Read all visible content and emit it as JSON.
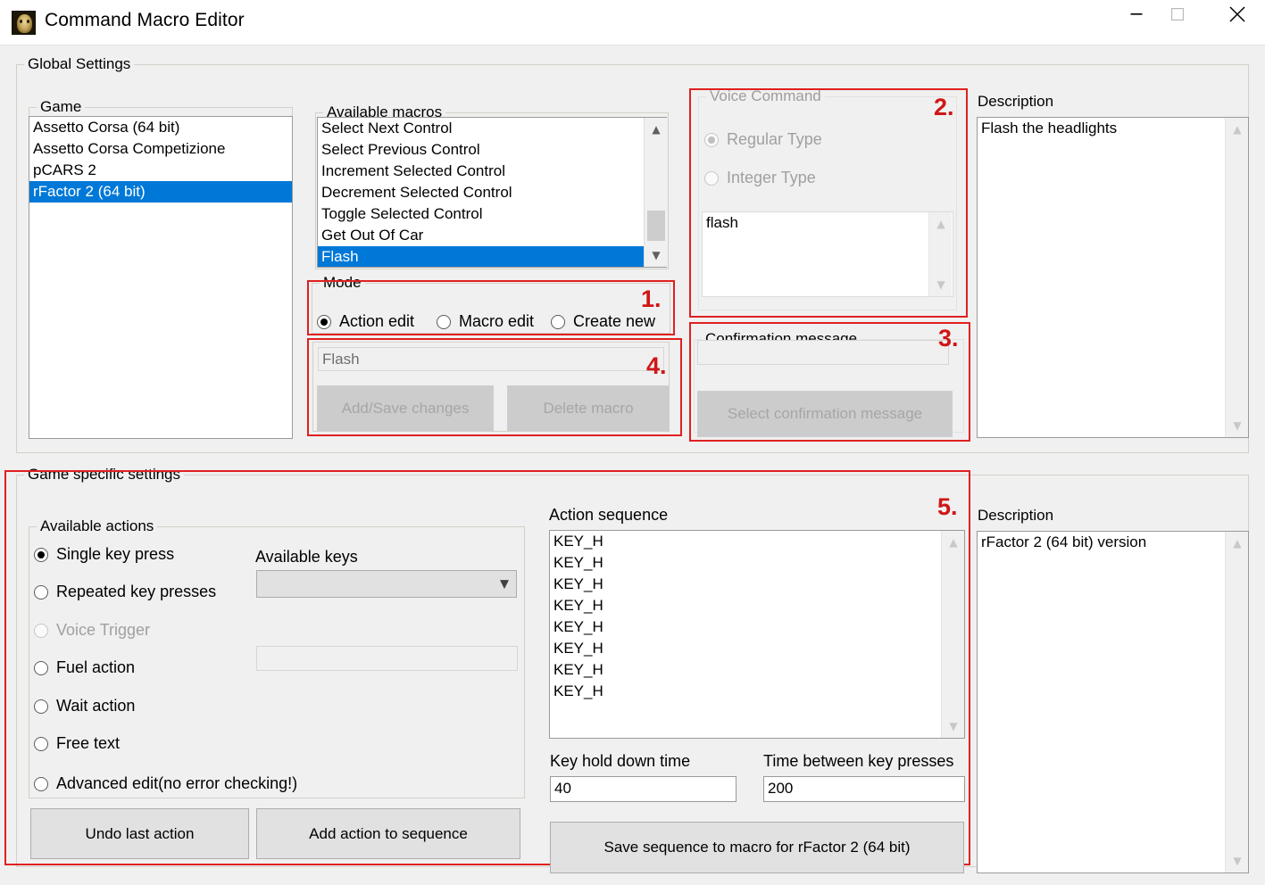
{
  "window": {
    "title": "Command Macro Editor",
    "icon": "app-face-icon",
    "controls": {
      "minimize": "minimize",
      "maximize": "maximize",
      "close": "close"
    }
  },
  "global_settings": {
    "title": "Global Settings",
    "game": {
      "label": "Game",
      "items": [
        "Assetto Corsa (64 bit)",
        "Assetto Corsa Competizione",
        "pCARS 2",
        "rFactor 2 (64 bit)"
      ],
      "selected": "rFactor 2 (64 bit)",
      "selected_index": 3
    },
    "available_macros": {
      "label": "Available macros",
      "items": [
        "Select Next Control",
        "Select Previous Control",
        "Increment Selected Control",
        "Decrement Selected Control",
        "Toggle Selected Control",
        "Get Out Of Car",
        "Flash"
      ],
      "selected": "Flash",
      "selected_index": 6
    },
    "mode": {
      "label": "Mode",
      "options": [
        "Action edit",
        "Macro edit",
        "Create new"
      ],
      "selected": "Action edit",
      "annotation": "1."
    },
    "macro_actions": {
      "macro_name_value": "Flash",
      "add_save_label": "Add/Save changes",
      "delete_label": "Delete macro",
      "enabled": false,
      "annotation": "4."
    },
    "voice_command": {
      "label": "Voice Command",
      "enabled": false,
      "options": [
        "Regular Type",
        "Integer Type"
      ],
      "selected": "Regular Type",
      "list_items": [
        "flash"
      ],
      "annotation": "2."
    },
    "confirmation_message": {
      "label": "Confirmation message",
      "field_value": "",
      "button_label": "Select confirmation message",
      "button_enabled": false,
      "annotation": "3."
    },
    "description": {
      "label": "Description",
      "text": "Flash the headlights"
    }
  },
  "game_specific_settings": {
    "title": "Game specific settings",
    "annotation": "5.",
    "available_actions": {
      "label": "Available actions",
      "options": [
        {
          "label": "Single key press",
          "enabled": true,
          "selected": true
        },
        {
          "label": "Repeated key presses",
          "enabled": true,
          "selected": false
        },
        {
          "label": "Voice Trigger",
          "enabled": false,
          "selected": false
        },
        {
          "label": "Fuel action",
          "enabled": true,
          "selected": false
        },
        {
          "label": "Wait action",
          "enabled": true,
          "selected": false
        },
        {
          "label": "Free text",
          "enabled": true,
          "selected": false
        },
        {
          "label": "Advanced edit(no error checking!)",
          "enabled": true,
          "selected": false
        }
      ]
    },
    "available_keys": {
      "label": "Available keys",
      "selected_value": "",
      "icon": "chevron-down-icon"
    },
    "parameter_field": {
      "value": ""
    },
    "undo_button": "Undo last action",
    "add_action_button": "Add action to sequence",
    "action_sequence": {
      "label": "Action sequence",
      "items": [
        "KEY_H",
        "KEY_H",
        "KEY_H",
        "KEY_H",
        "KEY_H",
        "KEY_H",
        "KEY_H",
        "KEY_H"
      ]
    },
    "key_hold_down_time": {
      "label": "Key hold down time",
      "value": "40"
    },
    "time_between_key_presses": {
      "label": "Time between key presses",
      "value": "200"
    },
    "save_sequence_button": "Save sequence to macro for rFactor 2 (64 bit)",
    "description": {
      "label": "Description",
      "text": "rFactor 2 (64 bit) version"
    }
  },
  "colors": {
    "accent_selection": "#0078d7",
    "annotation_red": "#e02020",
    "window_bg": "#f0f0f0"
  }
}
